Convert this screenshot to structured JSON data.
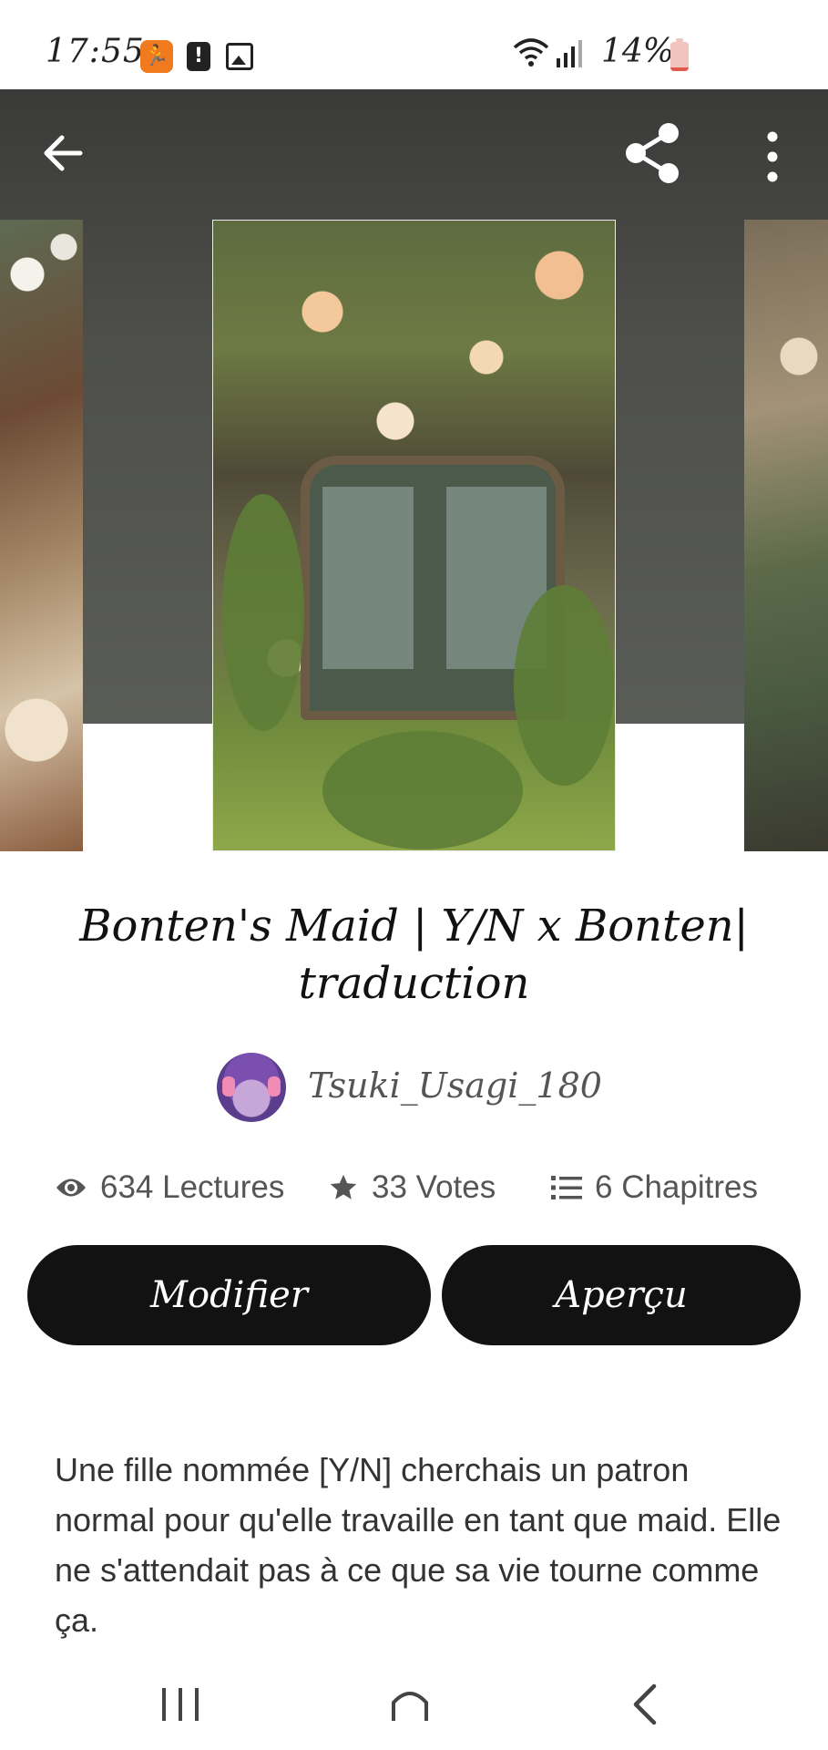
{
  "status_bar": {
    "time": "17:55",
    "battery": "14%",
    "battery_level": 0.14,
    "icons": [
      "running-icon",
      "alert-icon",
      "image-icon",
      "wifi-icon",
      "signal-icon",
      "battery-icon"
    ]
  },
  "header": {
    "back_icon": "arrow-left-icon",
    "share_icon": "share-icon",
    "more_icon": "more-vertical-icon"
  },
  "story": {
    "title": "Bonten's Maid | Y/N x Bonten| traduction",
    "author": "Tsuki_Usagi_180",
    "stats": {
      "reads": "634 Lectures",
      "votes": "33 Votes",
      "parts": "6 Chapitres"
    },
    "description": "Une fille nommée [Y/N] cherchais un patron normal pour qu'elle travaille en tant que maid. Elle ne s'attendait pas à ce que sa vie tourne comme ça."
  },
  "actions": {
    "edit_label": "Modifier",
    "preview_label": "Aperçu"
  },
  "nav": {
    "icons": [
      "recents-icon",
      "home-icon",
      "back-icon"
    ]
  },
  "colors": {
    "button_bg": "#121212",
    "hero_bg": "#4e4f4b",
    "accent_orange": "#f07a1e"
  }
}
